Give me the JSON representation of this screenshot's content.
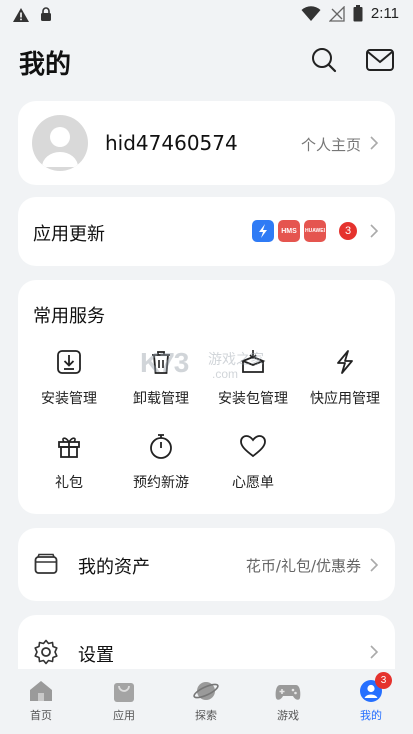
{
  "status_bar": {
    "time": "2:11"
  },
  "header": {
    "title": "我的"
  },
  "profile": {
    "username": "hid47460574",
    "homepage_label": "个人主页"
  },
  "updates": {
    "label": "应用更新",
    "apps": [
      {
        "name": "app-icon-blue-bolt"
      },
      {
        "name": "HMS"
      },
      {
        "name": "HUAWEI"
      }
    ],
    "count": "3"
  },
  "services": {
    "label": "常用服务",
    "items": [
      {
        "label": "安装管理",
        "icon": "install-manage-icon"
      },
      {
        "label": "卸载管理",
        "icon": "uninstall-manage-icon"
      },
      {
        "label": "安装包管理",
        "icon": "package-manage-icon"
      },
      {
        "label": "快应用管理",
        "icon": "quick-app-icon"
      },
      {
        "label": "礼包",
        "icon": "gift-icon"
      },
      {
        "label": "预约新游",
        "icon": "stopwatch-icon"
      },
      {
        "label": "心愿单",
        "icon": "heart-icon"
      }
    ]
  },
  "assets": {
    "label": "我的资产",
    "sub": "花币/礼包/优惠券"
  },
  "settings": {
    "label": "设置"
  },
  "tabs": [
    {
      "label": "首页",
      "icon": "home-icon"
    },
    {
      "label": "应用",
      "icon": "bag-icon"
    },
    {
      "label": "探索",
      "icon": "planet-icon"
    },
    {
      "label": "游戏",
      "icon": "gamepad-icon"
    },
    {
      "label": "我的",
      "icon": "user-icon",
      "active": true,
      "badge": "3"
    }
  ],
  "watermark": {
    "brand": "K73",
    "text": "游戏之家",
    "domain": ".com"
  },
  "colors": {
    "accent": "#256fff",
    "badge": "#e5322d",
    "background": "#f1f3f5"
  }
}
